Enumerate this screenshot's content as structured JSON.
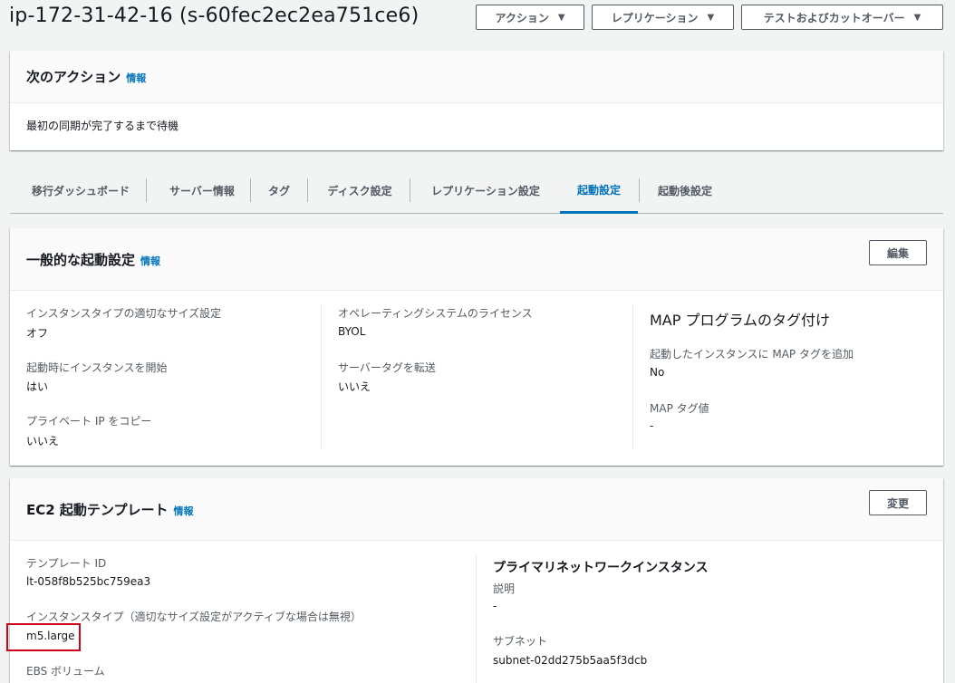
{
  "header": {
    "title": "ip-172-31-42-16 (s-60fec2ec2ea751ce6)",
    "buttons": [
      {
        "label": "アクション",
        "caret": "▼"
      },
      {
        "label": "レプリケーション",
        "caret": "▼"
      },
      {
        "label": "テストおよびカットオーバー",
        "caret": "▼"
      }
    ]
  },
  "next_action": {
    "title": "次のアクション",
    "info": "情報",
    "body": "最初の同期が完了するまで待機"
  },
  "tabs": [
    {
      "label": "移行ダッシュボード",
      "active": false
    },
    {
      "label": "サーバー情報",
      "active": false
    },
    {
      "label": "タグ",
      "active": false
    },
    {
      "label": "ディスク設定",
      "active": false
    },
    {
      "label": "レプリケーション設定",
      "active": false
    },
    {
      "label": "起動設定",
      "active": true
    },
    {
      "label": "起動後設定",
      "active": false
    }
  ],
  "general_launch": {
    "title": "一般的な起動設定",
    "info": "情報",
    "edit_label": "編集",
    "col1": [
      {
        "label": "インスタンスタイプの適切なサイズ設定",
        "value": "オフ"
      },
      {
        "label": "起動時にインスタンスを開始",
        "value": "はい"
      },
      {
        "label": "プライベート IP をコピー",
        "value": "いいえ"
      }
    ],
    "col2": [
      {
        "label": "オペレーティングシステムのライセンス",
        "value": "BYOL"
      },
      {
        "label": "サーバータグを転送",
        "value": "いいえ"
      }
    ],
    "map": {
      "title": "MAP プログラムのタグ付け",
      "items": [
        {
          "label": "起動したインスタンスに MAP タグを追加",
          "value": "No"
        },
        {
          "label": "MAP タグ値",
          "value": "-"
        }
      ]
    }
  },
  "ec2_template": {
    "title": "EC2 起動テンプレート",
    "info": "情報",
    "change_label": "変更",
    "left": [
      {
        "label": "テンプレート ID",
        "value": "lt-058f8b525bc759ea3"
      },
      {
        "label": "インスタンスタイプ（適切なサイズ設定がアクティブな場合は無視）",
        "value": "m5.large"
      },
      {
        "label": "EBS ボリューム",
        "value": ""
      }
    ],
    "right": {
      "title": "プライマリネットワークインスタンス",
      "items": [
        {
          "label": "説明",
          "value": "-"
        },
        {
          "label": "サブネット",
          "value": "subnet-02dd275b5aa5f3dcb"
        }
      ]
    }
  },
  "colors": {
    "accent": "#0073bb",
    "highlight": "#d0021b",
    "background": "#f2f3f3"
  }
}
